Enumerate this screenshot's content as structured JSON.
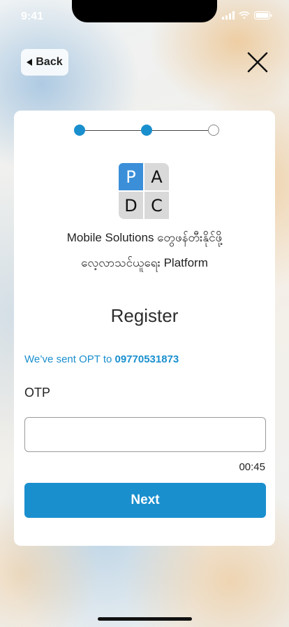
{
  "status_bar": {
    "time": "9:41"
  },
  "nav": {
    "back_label": "Back"
  },
  "stepper": {
    "total_steps": 3,
    "completed_steps": 2
  },
  "logo": {
    "cells": [
      "P",
      "A",
      "D",
      "C"
    ]
  },
  "tagline": {
    "line1": "Mobile  Solutions  တွေဖန်တီးနိုင်ဖို့",
    "line2": "လေ့လာသင်ယူရေး  Platform"
  },
  "form": {
    "heading": "Register",
    "sent_prefix": "We’ve sent OPT to ",
    "sent_phone": "09770531873",
    "otp_label": "OTP",
    "otp_value": "",
    "timer": "00:45",
    "next_label": "Next"
  },
  "colors": {
    "accent": "#1a8fce",
    "logo_primary": "#3b8fd9"
  }
}
